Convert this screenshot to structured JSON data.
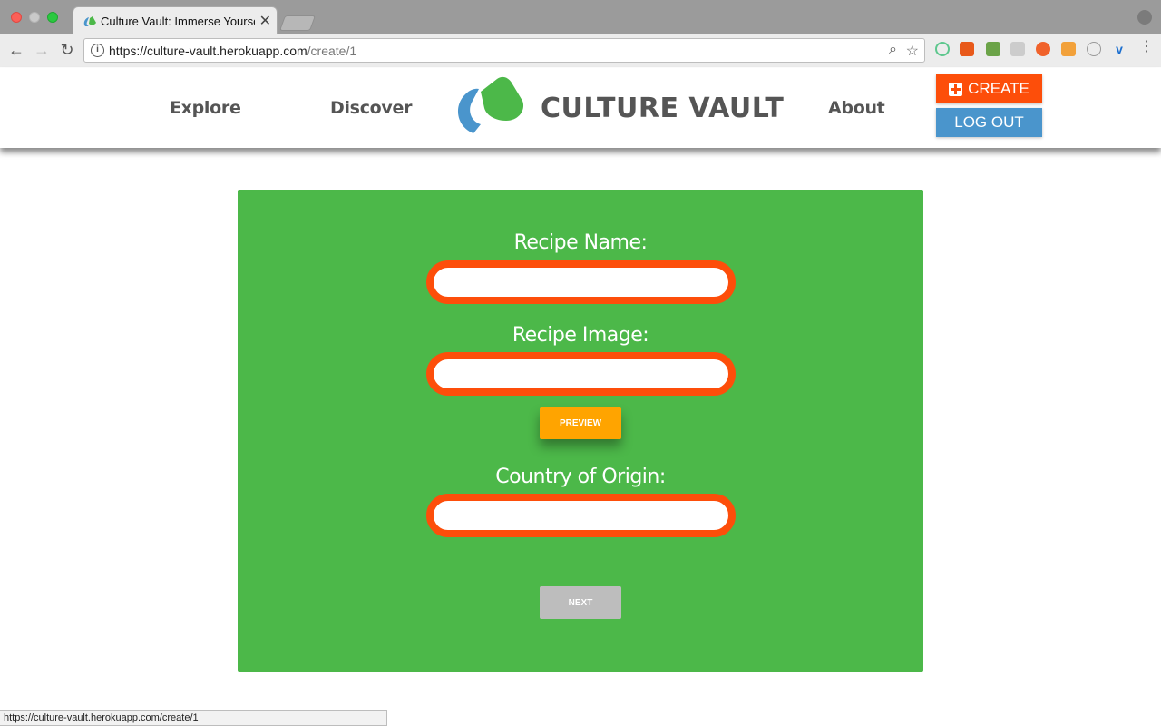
{
  "browser": {
    "tab_title": "Culture Vault: Immerse Yoursel",
    "tab_close": "✕",
    "url_host": "https://culture-vault.herokuapp.com",
    "url_path": "/create/1",
    "status_url": "https://culture-vault.herokuapp.com/create/1"
  },
  "header": {
    "nav": {
      "explore": "Explore",
      "discover": "Discover",
      "about": "About"
    },
    "logo_text": "CULTURE VAULT",
    "create_label": "CREATE",
    "logout_label": "LOG OUT"
  },
  "form": {
    "recipe_name_label": "Recipe Name:",
    "recipe_name_value": "",
    "recipe_image_label": "Recipe Image:",
    "recipe_image_value": "",
    "preview_label": "PREVIEW",
    "country_label": "Country of Origin:",
    "country_value": "",
    "next_label": "NEXT"
  },
  "colors": {
    "panel_green": "#4cb849",
    "input_border_orange": "#fd4e0a",
    "preview_orange": "#ffa400",
    "create_orange": "#fd4e0a",
    "logout_blue": "#4a95cc",
    "next_gray": "#bdbdbd"
  }
}
